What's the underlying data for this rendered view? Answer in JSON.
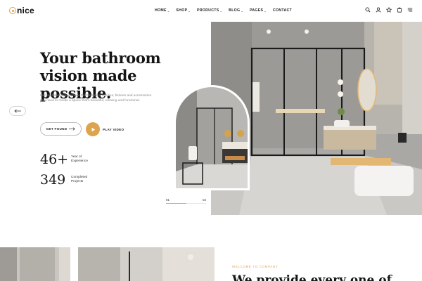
{
  "brand": {
    "name": "nice",
    "accent": "#dda44e"
  },
  "nav": {
    "items": [
      {
        "label": "HOME",
        "has_dropdown": true
      },
      {
        "label": "SHOP",
        "has_dropdown": true
      },
      {
        "label": "PRODUCTS",
        "has_dropdown": true
      },
      {
        "label": "BLOG",
        "has_dropdown": true
      },
      {
        "label": "PAGES",
        "has_dropdown": true
      },
      {
        "label": "CONTACT",
        "has_dropdown": false
      }
    ],
    "icons": [
      "search-icon",
      "user-icon",
      "wishlist-icon",
      "cart-icon",
      "menu-icon"
    ]
  },
  "hero": {
    "title_line1": "Your bathroom",
    "title_line2": "vision made possible.",
    "description": "Our exclusive brands have the bathroom vanities, fixtures and accessories you need to create a space that's beautiful, relaxing and functional.",
    "primary_button": "GET FOUND",
    "video_button": "PLAY VIDEO",
    "stats": [
      {
        "value": "46+",
        "label_line1": "Year of",
        "label_line2": "Experience"
      },
      {
        "value": "349",
        "label_line1": "Completed",
        "label_line2": "Projects"
      }
    ]
  },
  "slider": {
    "current": "01",
    "total": "02",
    "progress_fraction": 0.5
  },
  "about": {
    "eyebrow": "WELCOME TO COMPANY",
    "heading": "We provide every one of"
  }
}
